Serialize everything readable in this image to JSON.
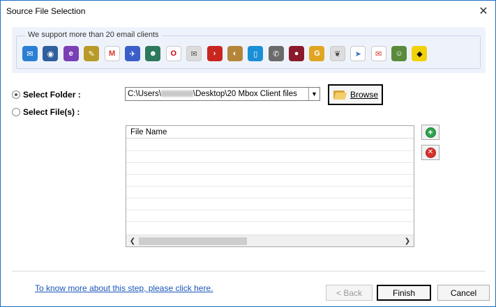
{
  "window": {
    "title": "Source File Selection"
  },
  "clients": {
    "label": "We support more than 20 email clients",
    "icons": [
      {
        "name": "mail-envelope-icon",
        "color": "#2a7fd4",
        "glyph": "✉"
      },
      {
        "name": "thunderbird-icon",
        "color": "#2f5f9e",
        "glyph": "◉"
      },
      {
        "name": "eudora-icon",
        "color": "#7b3fb5",
        "glyph": "e"
      },
      {
        "name": "pocomail-icon",
        "color": "#b89a2a",
        "glyph": "✎"
      },
      {
        "name": "gmail-icon",
        "color": "#ffffff",
        "glyph": "M",
        "fg": "#d93025"
      },
      {
        "name": "spicebird-icon",
        "color": "#3b5fc8",
        "glyph": "✈"
      },
      {
        "name": "seamonkey-icon",
        "color": "#2c7a5b",
        "glyph": "☻"
      },
      {
        "name": "opera-icon",
        "color": "#ffffff",
        "glyph": "O",
        "fg": "#d0021b"
      },
      {
        "name": "apple-mail-icon",
        "color": "#dcdcdc",
        "glyph": "✉",
        "fg": "#555"
      },
      {
        "name": "mailpilot-icon",
        "color": "#c8261f",
        "glyph": "›"
      },
      {
        "name": "postbox-icon",
        "color": "#b5853a",
        "glyph": "◐"
      },
      {
        "name": "mozilla-icon",
        "color": "#1a8fd6",
        "glyph": "▯"
      },
      {
        "name": "entourage-icon",
        "color": "#6a6a6a",
        "glyph": "✆"
      },
      {
        "name": "sylpheed-icon",
        "color": "#8b1a2b",
        "glyph": "●"
      },
      {
        "name": "gyazmail-icon",
        "color": "#e0a623",
        "glyph": "G"
      },
      {
        "name": "claws-icon",
        "color": "#dddddd",
        "glyph": "❦",
        "fg": "#444"
      },
      {
        "name": "mulberry-icon",
        "color": "#ffffff",
        "glyph": "➤",
        "fg": "#3a6fb6"
      },
      {
        "name": "netscape-mail-icon",
        "color": "#ffffff",
        "glyph": "✉",
        "fg": "#d0302a"
      },
      {
        "name": "evolution-icon",
        "color": "#5b8a3a",
        "glyph": "☺"
      },
      {
        "name": "batman-icon",
        "color": "#f1d10a",
        "glyph": "◆",
        "fg": "#111"
      }
    ]
  },
  "source": {
    "select_folder_label": "Select Folder :",
    "select_files_label": "Select File(s) :",
    "path_prefix": "C:\\Users\\",
    "path_suffix": "\\Desktop\\20 Mbox Client files",
    "browse_label": "Browse"
  },
  "file_list": {
    "column_header": "File Name",
    "rows": []
  },
  "footer": {
    "help_link": "To know more about this step, please click here.",
    "back_label": "< Back",
    "finish_label": "Finish",
    "cancel_label": "Cancel"
  }
}
